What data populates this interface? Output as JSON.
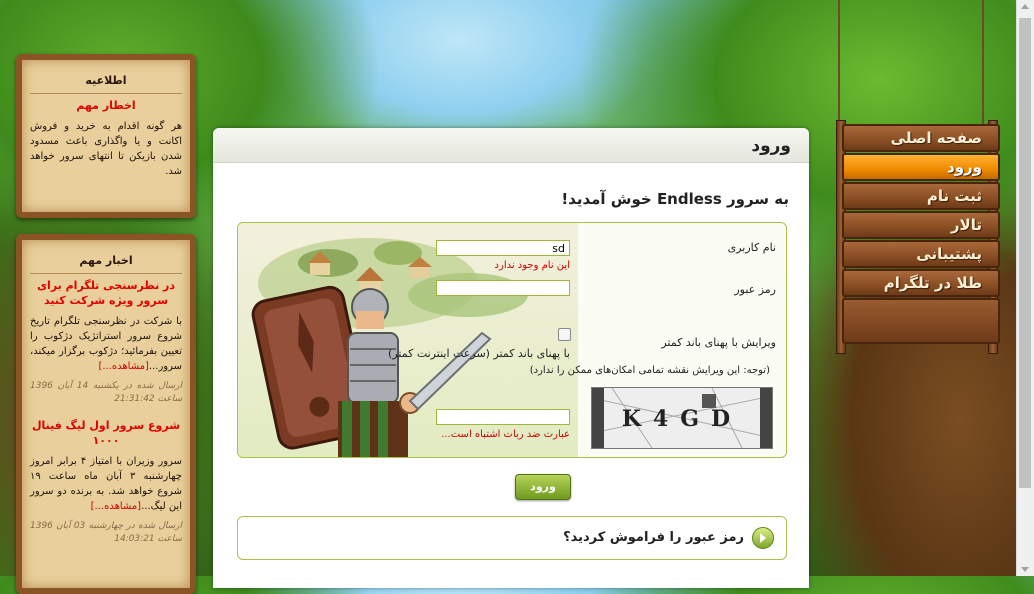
{
  "announcement": {
    "title": "اطلاعیه",
    "headline": "اخطار مهم",
    "body": "هر گونه اقدام به خرید و فروش اکانت و یا واگذاری باعث مسدود شدن بازیکن تا انتهای سرور خواهد شد."
  },
  "news": {
    "title": "اخبار مهم",
    "items": [
      {
        "headline": "در نظرسنجی تلگرام برای سرور ویژه شرکت کنید",
        "body": "با شرکت در نظرسنجی تلگرام تاریخ شروع سرور استراتژیک دژکوب را تعیین بفرمائید؛ دژکوب برگزار میکند، سرور...",
        "more": "[مشاهده...]",
        "meta": "ارسال شده در یکشنبه 14 آبان 1396 ساعت 21:31:42"
      },
      {
        "headline": "شروع سرور اول لیگ فینال ۱۰۰۰",
        "body": "سرور وزیران با امتیاز ۴ برابر امروز چهارشنبه ۳ آبان ماه ساعت ۱۹ شروع خواهد شد. به برنده دو سرور این لیگ...",
        "more": "[مشاهده...]",
        "meta": "ارسال شده در چهارشنبه 03 آبان 1396 ساعت 14:03:21"
      }
    ]
  },
  "main": {
    "title": "ورود",
    "welcome": "به سرور Endless خوش آمدید!",
    "username_label": "نام کاربری",
    "username_value": "sd",
    "username_error": "این نام وجود ندارد",
    "password_label": "رمز عبور",
    "password_value": "",
    "lowbw_label": "ویرایش با پهنای باند کمتر",
    "lowbw_option": "با پهنای باند کمتر (سرعت اینترنت کمتر)",
    "lowbw_note": "(توجه: این ویرایش نقشه تمامی امکان‌های ممکن را ندارد)",
    "captcha_text": "K4GD",
    "captcha_value": "",
    "captcha_error": "عبارت ضد ربات اشتباه است...",
    "login_button": "ورود",
    "forgot": "رمز عبور را فراموش کردید؟"
  },
  "nav": {
    "items": [
      {
        "label": "صفحه اصلی",
        "active": false
      },
      {
        "label": "ورود",
        "active": true
      },
      {
        "label": "ثبت نام",
        "active": false
      },
      {
        "label": "تالار",
        "active": false
      },
      {
        "label": "پشتیبانی",
        "active": false
      },
      {
        "label": "طلا در تلگرام",
        "active": false
      }
    ]
  },
  "colors": {
    "accent_green": "#8fb52a",
    "error_red": "#d00000",
    "nav_active": "#f08a00"
  }
}
